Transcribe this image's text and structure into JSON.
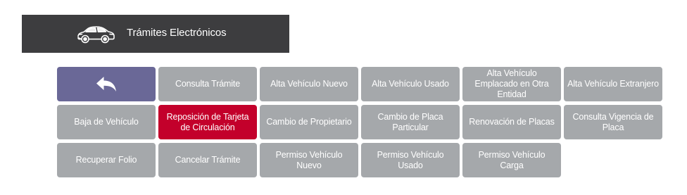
{
  "header": {
    "title": "Trámites Electrónicos",
    "icon": "car-icon",
    "background": "#3d3d3f"
  },
  "grid": {
    "back_icon": "back-arrow-icon",
    "colors": {
      "tile": "#a5a8ab",
      "back": "#6a6897",
      "active": "#c3002b"
    },
    "tiles": [
      {
        "id": "back",
        "label": ""
      },
      {
        "id": "consulta-tramite",
        "label": "Consulta Trámite"
      },
      {
        "id": "alta-vehiculo-nuevo",
        "label": "Alta Vehículo Nuevo"
      },
      {
        "id": "alta-vehiculo-usado",
        "label": "Alta Vehículo Usado"
      },
      {
        "id": "alta-vehiculo-emplacado",
        "label": "Alta Vehículo Emplacado en Otra Entidad"
      },
      {
        "id": "alta-vehiculo-extranjero",
        "label": "Alta Vehículo Extranjero"
      },
      {
        "id": "baja-de-vehiculo",
        "label": "Baja de Vehículo"
      },
      {
        "id": "reposicion-tarjeta",
        "label": "Reposición de Tarjeta de Circulación",
        "active": true
      },
      {
        "id": "cambio-de-propietario",
        "label": "Cambio de Propietario"
      },
      {
        "id": "cambio-placa-particular",
        "label": "Cambio de Placa Particular"
      },
      {
        "id": "renovacion-de-placas",
        "label": "Renovación de Placas"
      },
      {
        "id": "consulta-vigencia-placa",
        "label": "Consulta Vigencia de Placa"
      },
      {
        "id": "recuperar-folio",
        "label": "Recuperar Folio"
      },
      {
        "id": "cancelar-tramite",
        "label": "Cancelar Trámite"
      },
      {
        "id": "permiso-vehiculo-nuevo",
        "label": "Permiso Vehículo Nuevo"
      },
      {
        "id": "permiso-vehiculo-usado",
        "label": "Permiso Vehículo Usado"
      },
      {
        "id": "permiso-vehiculo-carga",
        "label": "Permiso Vehículo Carga"
      }
    ]
  }
}
